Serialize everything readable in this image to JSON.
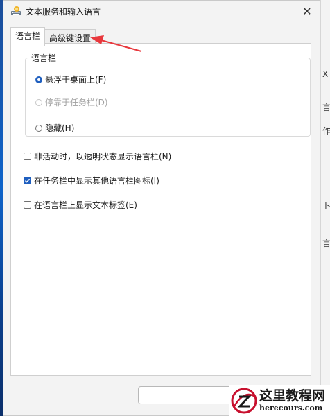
{
  "window": {
    "title": "文本服务和输入语言",
    "close_glyph": "✕"
  },
  "tabs": [
    {
      "label": "语言栏",
      "active": true
    },
    {
      "label": "高级键设置",
      "active": false
    }
  ],
  "group": {
    "legend": "语言栏",
    "radios": [
      {
        "label": "悬浮于桌面上(F)",
        "checked": true,
        "disabled": false
      },
      {
        "label": "停靠于任务栏(D)",
        "checked": false,
        "disabled": true
      },
      {
        "label": "隐藏(H)",
        "checked": false,
        "disabled": false
      }
    ]
  },
  "checkboxes": [
    {
      "label": "非活动时，以透明状态显示语言栏(N)",
      "checked": false
    },
    {
      "label": "在任务栏中显示其他语言栏图标(I)",
      "checked": true
    },
    {
      "label": "在语言栏上显示文本标签(E)",
      "checked": false
    }
  ],
  "background_app": {
    "chars": [
      "X",
      "言",
      "作",
      "卜",
      "言"
    ]
  },
  "watermark": {
    "title": "这里教程网",
    "url": "herecours.com"
  },
  "colors": {
    "accent": "#1f5fbf",
    "arrow": "#e8383d"
  }
}
